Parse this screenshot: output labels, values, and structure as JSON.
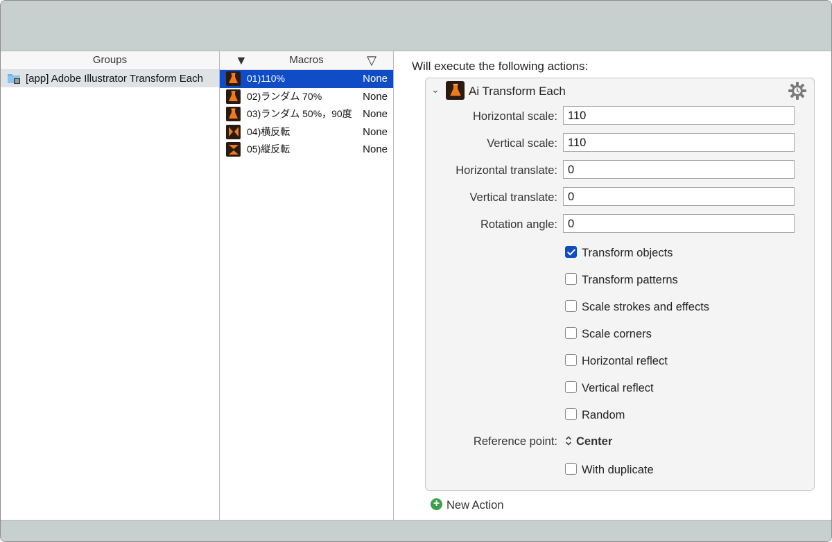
{
  "groups": {
    "header": "Groups",
    "items": [
      {
        "label": "[app] Adobe Illustrator Transform Each",
        "icon": "folder-list-icon"
      }
    ]
  },
  "macros": {
    "header": "Macros",
    "sort_desc_glyph": "▼",
    "sort_asc_glyph": "▽",
    "items": [
      {
        "name": "01)110%",
        "trigger": "None",
        "icon": "flask-icon",
        "selected": true
      },
      {
        "name": "02)ランダム 70%",
        "trigger": "None",
        "icon": "flask-icon",
        "selected": false
      },
      {
        "name": "03)ランダム 50%，90度",
        "trigger": "None",
        "icon": "flask-icon",
        "selected": false
      },
      {
        "name": "04)横反転",
        "trigger": "None",
        "icon": "flip-horizontal-icon",
        "selected": false
      },
      {
        "name": "05)縦反転",
        "trigger": "None",
        "icon": "flip-vertical-icon",
        "selected": false
      }
    ]
  },
  "detail": {
    "title": "Will execute the following actions:",
    "action": {
      "title": "Ai Transform Each",
      "fields": [
        {
          "label": "Horizontal scale:",
          "value": "110"
        },
        {
          "label": "Vertical scale:",
          "value": "110"
        },
        {
          "label": "Horizontal translate:",
          "value": "0"
        },
        {
          "label": "Vertical translate:",
          "value": "0"
        },
        {
          "label": "Rotation angle:",
          "value": "0"
        }
      ],
      "checkboxes": [
        {
          "label": "Transform objects",
          "checked": true
        },
        {
          "label": "Transform patterns",
          "checked": false
        },
        {
          "label": "Scale strokes and effects",
          "checked": false
        },
        {
          "label": "Scale corners",
          "checked": false
        },
        {
          "label": "Horizontal reflect",
          "checked": false
        },
        {
          "label": "Vertical reflect",
          "checked": false
        },
        {
          "label": "Random",
          "checked": false
        }
      ],
      "reference_point": {
        "label": "Reference point:",
        "value": "Center",
        "glyph": "⌃⌄"
      },
      "with_duplicate": {
        "label": "With duplicate",
        "checked": false
      }
    },
    "new_action": "New Action"
  },
  "colors": {
    "selection": "#0f4cc5",
    "toolbar": "#c7cfcf",
    "icon_orange": "#f07a1a",
    "add_green": "#3aa04a"
  }
}
